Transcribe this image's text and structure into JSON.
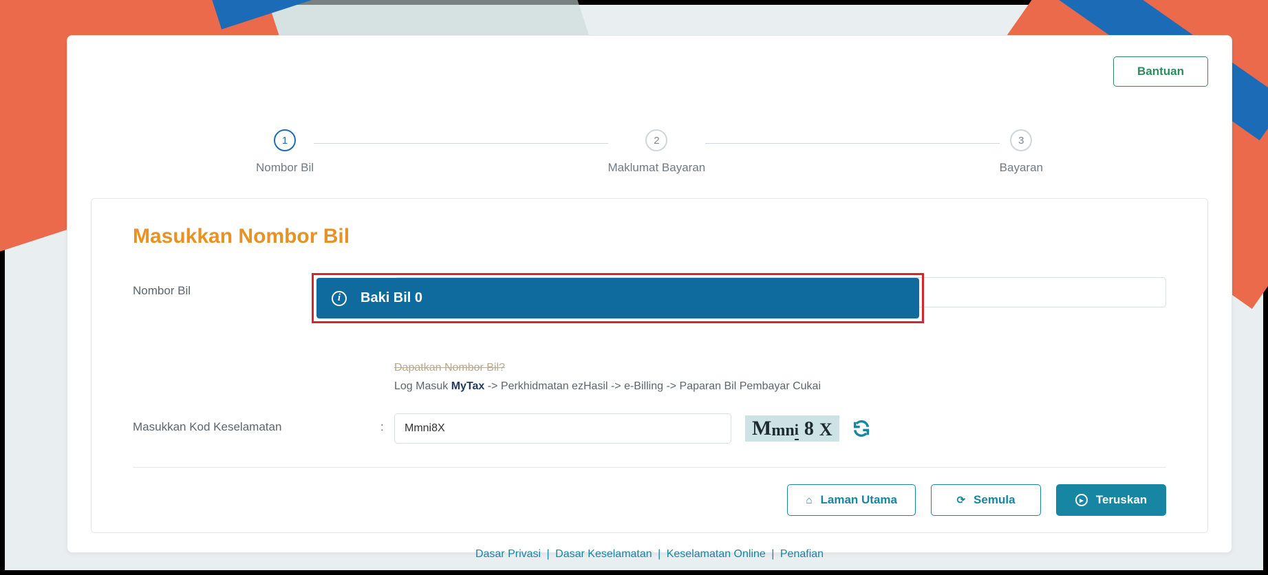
{
  "help_label": "Bantuan",
  "steps": [
    {
      "num": "1",
      "label": "Nombor Bil"
    },
    {
      "num": "2",
      "label": "Maklumat Bayaran"
    },
    {
      "num": "3",
      "label": "Bayaran"
    }
  ],
  "section_title": "Masukkan Nombor Bil",
  "fields": {
    "bill_number_label": "Nombor Bil",
    "colon": ":",
    "alert_text": "Baki Bil 0",
    "hint_question": "Dapatkan Nombor Bil?",
    "hint_prefix": "Log Masuk ",
    "hint_brand": "MyTax",
    "hint_suffix": " -> Perkhidmatan ezHasil -> e-Billing -> Paparan Bil Pembayar Cukai",
    "security_label": "Masukkan Kod Keselamatan",
    "security_value": "Mmni8X",
    "captcha_chars": [
      "M",
      "m",
      "n",
      "i",
      "8",
      "X"
    ]
  },
  "buttons": {
    "home": "Laman Utama",
    "reset": "Semula",
    "next": "Teruskan"
  },
  "footer": {
    "privacy": "Dasar Privasi",
    "security": "Dasar Keselamatan",
    "online_security": "Keselamatan Online",
    "disclaimer": "Penafian",
    "sep": " | "
  }
}
